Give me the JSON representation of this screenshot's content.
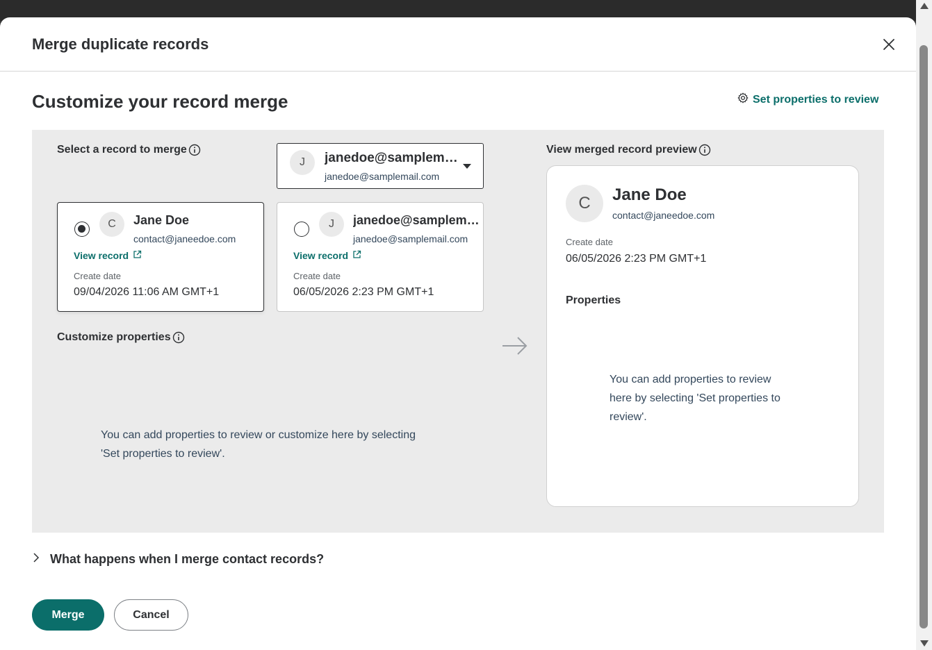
{
  "colors": {
    "accent": "#0b6e6a",
    "panel_bg": "#ebebeb",
    "text": "#2e3033"
  },
  "modal": {
    "title": "Merge duplicate records",
    "close_icon": "close-icon"
  },
  "main": {
    "title": "Customize your record merge",
    "set_properties_link": "Set properties to review",
    "set_properties_icon": "gear-icon"
  },
  "select_section": {
    "label": "Select a record to merge",
    "dropdown": {
      "avatar_initial": "J",
      "name": "janedoe@samplemail.com",
      "email": "janedoe@samplemail.com"
    },
    "records": [
      {
        "selected": true,
        "avatar_initial": "C",
        "name": "Jane Doe",
        "email": "contact@janeedoe.com",
        "view_record": "View record",
        "create_date_label": "Create date",
        "create_date": "09/04/2026 11:06 AM GMT+1"
      },
      {
        "selected": false,
        "avatar_initial": "J",
        "name": "janedoe@samplemail.com",
        "email": "janedoe@samplemail.com",
        "view_record": "View record",
        "create_date_label": "Create date",
        "create_date": "06/05/2026 2:23 PM GMT+1"
      }
    ]
  },
  "customize_section": {
    "label": "Customize properties",
    "empty_note_line1": "You can add properties to review or customize here by selecting",
    "empty_note_line2": "'Set properties to review'."
  },
  "preview": {
    "label": "View merged record preview",
    "avatar_initial": "C",
    "name": "Jane Doe",
    "email": "contact@janeedoe.com",
    "create_date_label": "Create date",
    "create_date": "06/05/2026 2:23 PM GMT+1",
    "properties_label": "Properties",
    "empty_note_line1": "You can add properties to review",
    "empty_note_line2": "here by selecting 'Set properties to",
    "empty_note_line3": "review'."
  },
  "faq": {
    "text": "What happens when I merge contact records?"
  },
  "footer": {
    "merge_label": "Merge",
    "cancel_label": "Cancel"
  }
}
